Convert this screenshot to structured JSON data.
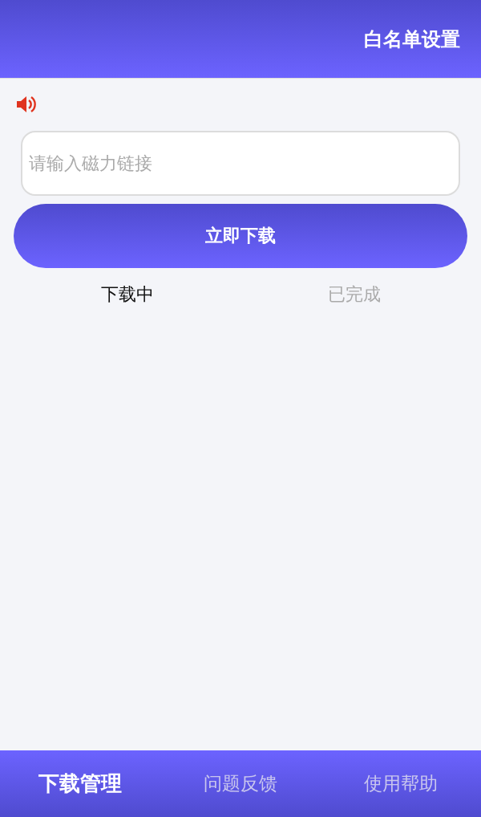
{
  "header": {
    "action": "白名单设置"
  },
  "search": {
    "placeholder": "请输入磁力链接"
  },
  "download_button": "立即下载",
  "tabs": [
    {
      "label": "下载中",
      "selected": true
    },
    {
      "label": "已完成",
      "selected": false
    }
  ],
  "bottom_nav": [
    {
      "label": "下载管理",
      "selected": true
    },
    {
      "label": "问题反馈",
      "selected": false
    },
    {
      "label": "使用帮助",
      "selected": false
    }
  ]
}
